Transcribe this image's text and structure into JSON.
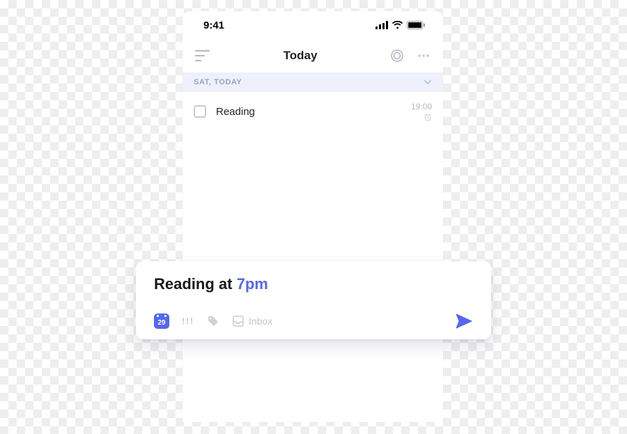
{
  "status_bar": {
    "time": "9:41"
  },
  "nav": {
    "title": "Today"
  },
  "section": {
    "label": "SAT, TODAY"
  },
  "tasks": [
    {
      "title": "Reading",
      "time": "19:00"
    }
  ],
  "compose": {
    "text_prefix": "Reading at ",
    "time_token": "7pm",
    "calendar_day": "29",
    "priority_glyph": "!!!",
    "list_label": "Inbox"
  }
}
